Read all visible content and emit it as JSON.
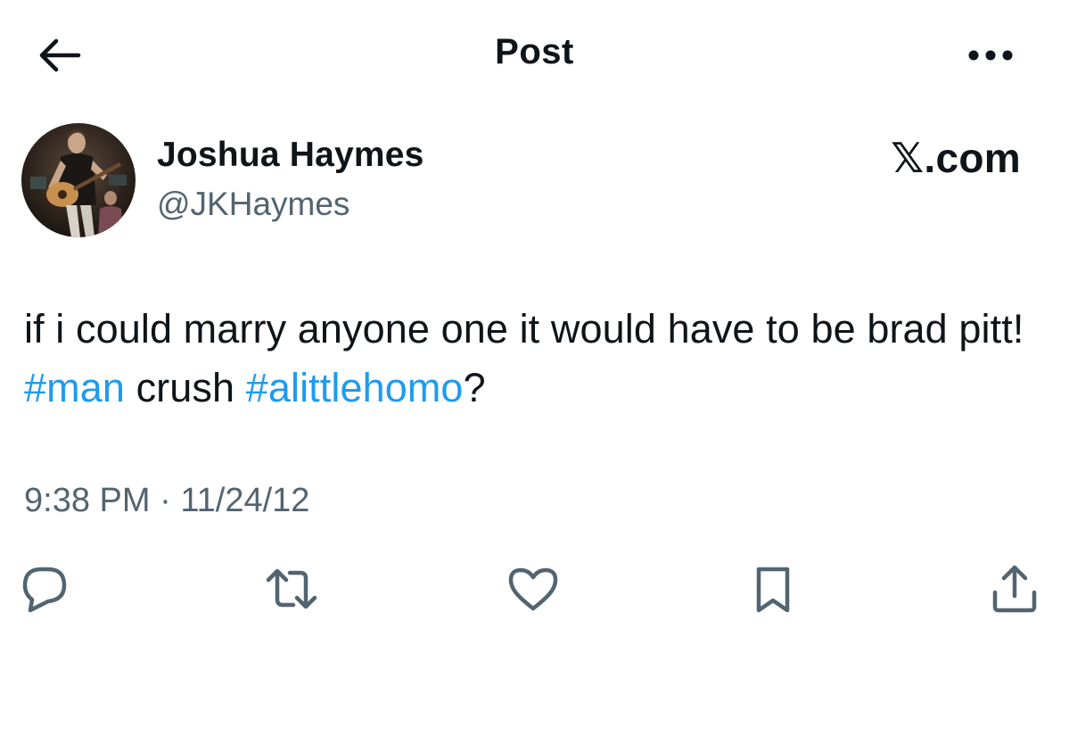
{
  "header": {
    "title": "Post",
    "back_icon": "arrow-left-icon",
    "more_icon": "more-horizontal-icon"
  },
  "author": {
    "display_name": "Joshua Haymes",
    "handle": "@JKHaymes",
    "avatar": "avatar-photo-guitar-player"
  },
  "brand": {
    "label": "𝕏.com"
  },
  "post": {
    "segments": [
      {
        "text": "if i could marry anyone one it would have to be brad pitt! ",
        "type": "text"
      },
      {
        "text": "#man",
        "type": "hashtag"
      },
      {
        "text": " crush ",
        "type": "text"
      },
      {
        "text": "#alittlehomo",
        "type": "hashtag"
      },
      {
        "text": "?",
        "type": "text"
      }
    ]
  },
  "meta": {
    "time": "9:38 PM",
    "separator": " · ",
    "date": "11/24/12"
  },
  "actions": {
    "reply_icon": "reply-icon",
    "repost_icon": "repost-icon",
    "like_icon": "heart-icon",
    "bookmark_icon": "bookmark-icon",
    "share_icon": "share-icon"
  },
  "colors": {
    "text": "#0f1419",
    "secondary": "#536471",
    "accent": "#1d9bf0"
  }
}
